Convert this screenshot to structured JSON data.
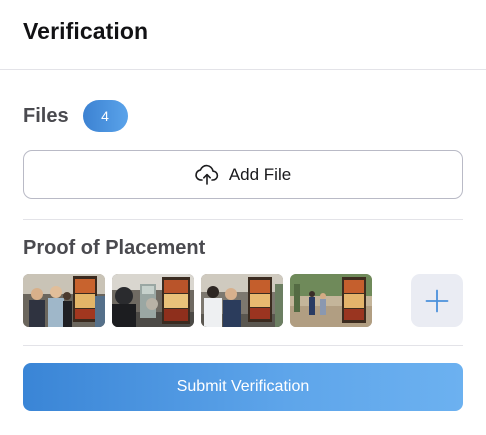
{
  "header": {
    "title": "Verification"
  },
  "files": {
    "label": "Files",
    "count": "4"
  },
  "add_file": {
    "label": "Add File",
    "icon": "cloud-upload-icon"
  },
  "proof": {
    "label": "Proof of Placement",
    "thumbnails": [
      {
        "name": "placement-photo-1"
      },
      {
        "name": "placement-photo-2"
      },
      {
        "name": "placement-photo-3"
      },
      {
        "name": "placement-photo-4"
      }
    ],
    "add_icon": "plus-icon"
  },
  "submit": {
    "label": "Submit Verification"
  },
  "colors": {
    "accent": "#3a85d6",
    "accent_light": "#6cb1f0",
    "divider": "#e3e3e8",
    "add_tile_bg": "#eaecf3"
  }
}
